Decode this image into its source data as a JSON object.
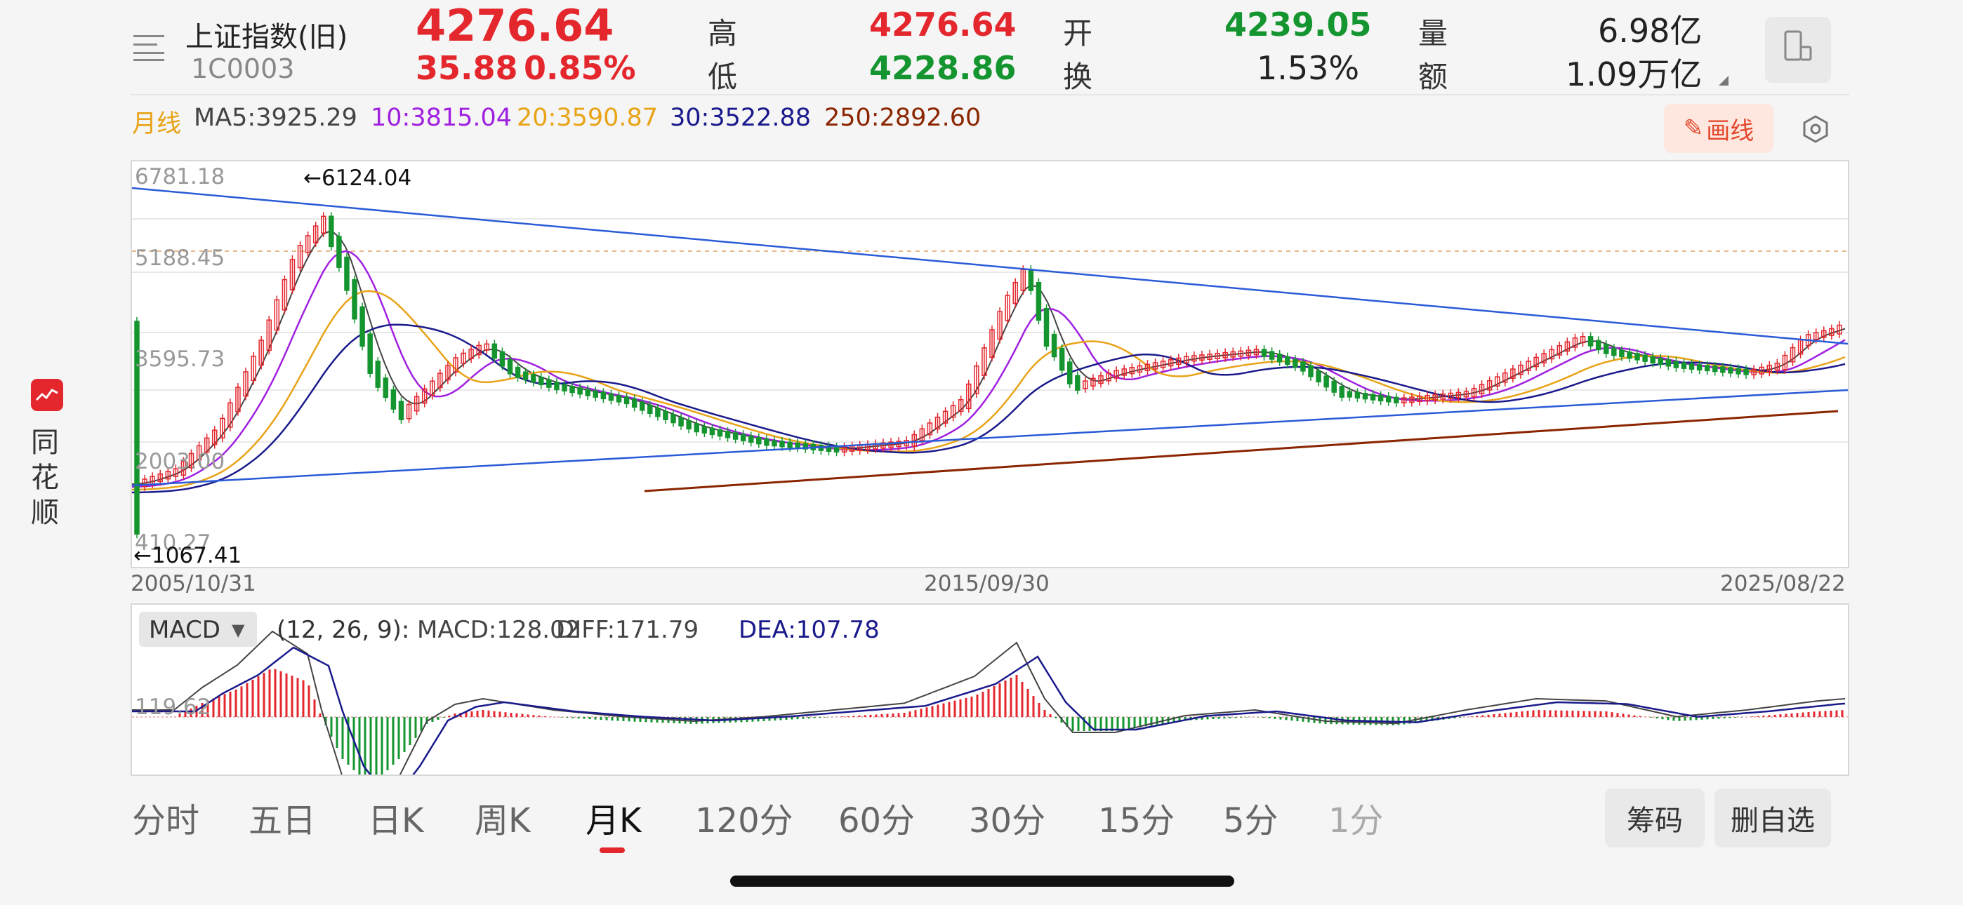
{
  "header": {
    "name": "上证指数(旧)",
    "code": "1C0003",
    "price": "4276.64",
    "change": "35.88",
    "change_pct": "0.85%",
    "high_label": "高",
    "high": "4276.64",
    "low_label": "低",
    "low": "4228.86",
    "open_label": "开",
    "open": "4239.05",
    "turnover_label": "换",
    "turnover": "1.53%",
    "volume_label": "量",
    "volume": "6.98亿",
    "amount_label": "额",
    "amount": "1.09万亿"
  },
  "ma_bar": {
    "period": "月线",
    "ma5": "MA5:3925.29",
    "ma10": "10:3815.04",
    "ma20": "20:3590.87",
    "ma30": "30:3522.88",
    "ma250": "250:2892.60",
    "draw_button": "画线"
  },
  "brand": {
    "chars": [
      "同",
      "花",
      "顺"
    ]
  },
  "chart": {
    "y_labels": [
      "6781.18",
      "5188.45",
      "3595.73",
      "2003.00",
      "410.27"
    ],
    "x_labels": [
      "2005/10/31",
      "2015/09/30",
      "2025/08/22"
    ],
    "high_annotation": "←6124.04",
    "low_annotation": "←1067.41"
  },
  "macd": {
    "indicator": "MACD",
    "params": "(12, 26, 9):",
    "macd": "MACD:128.02",
    "diff": "DIFF:171.79",
    "dea": "DEA:107.78",
    "y_label": "119.62"
  },
  "tabs": [
    "分时",
    "五日",
    "日K",
    "周K",
    "月K",
    "120分",
    "60分",
    "30分",
    "15分",
    "5分",
    "1分"
  ],
  "active_tab": "月K",
  "buttons": {
    "chips": "筹码",
    "remove_watch": "删自选"
  },
  "colors": {
    "up": "#e4262d",
    "down": "#15952f",
    "ma5": "#444444",
    "ma10": "#a020e0",
    "ma20": "#e8a317",
    "ma30": "#1a1a8c",
    "ma250": "#8b2500",
    "trendline": "#2a5bd7",
    "brand": "#e4262d"
  }
}
